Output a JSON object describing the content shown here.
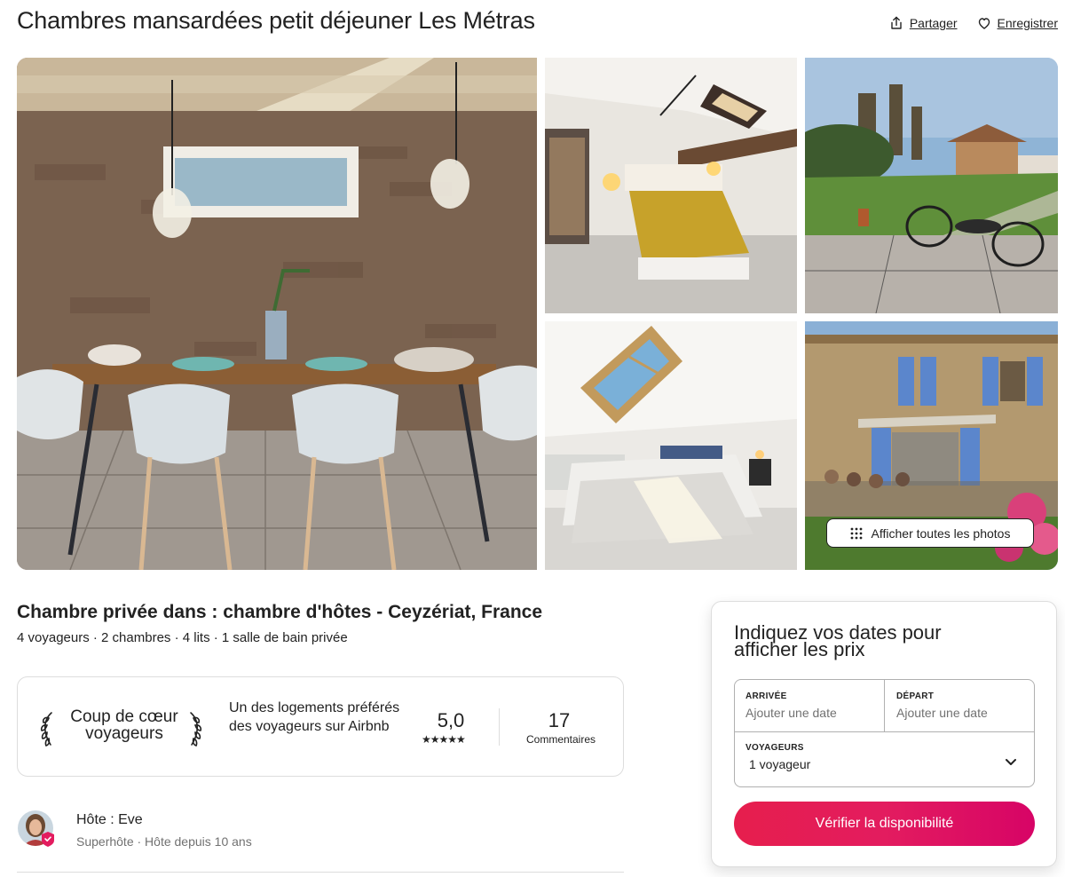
{
  "listing": {
    "title": "Chambres mansardées petit déjeuner Les Métras",
    "share_label": "Partager",
    "save_label": "Enregistrer",
    "show_all_photos": "Afficher toutes les photos",
    "subtitle": "Chambre privée dans : chambre d'hôtes - Ceyzériat, France",
    "specs": "4 voyageurs · 2 chambres · 4 lits · 1 salle de bain privée"
  },
  "guest_favorite": {
    "label": "Coup de cœur voyageurs",
    "description": "Un des logements préférés des voyageurs sur Airbnb",
    "rating": "5,0",
    "stars": "★★★★★",
    "reviews_count": "17",
    "reviews_label": "Commentaires"
  },
  "host": {
    "name": "Hôte : Eve",
    "meta": "Superhôte · Hôte depuis 10 ans"
  },
  "booking": {
    "title": "Indiquez vos dates pour afficher les prix",
    "checkin_label": "ARRIVÉE",
    "checkin_placeholder": "Ajouter une date",
    "checkout_label": "DÉPART",
    "checkout_placeholder": "Ajouter une date",
    "guests_label": "VOYAGEURS",
    "guests_value": "1 voyageur",
    "cta": "Vérifier la disponibilité"
  },
  "colors": {
    "brand": "#e31c5f",
    "text": "#222222",
    "muted": "#717171",
    "border": "#dddddd"
  },
  "icons": {
    "share": "share-icon",
    "save": "heart-icon",
    "grid": "grid-dots-icon",
    "laurel_left": "laurel-left-icon",
    "laurel_right": "laurel-right-icon",
    "chevron": "chevron-down-icon"
  }
}
